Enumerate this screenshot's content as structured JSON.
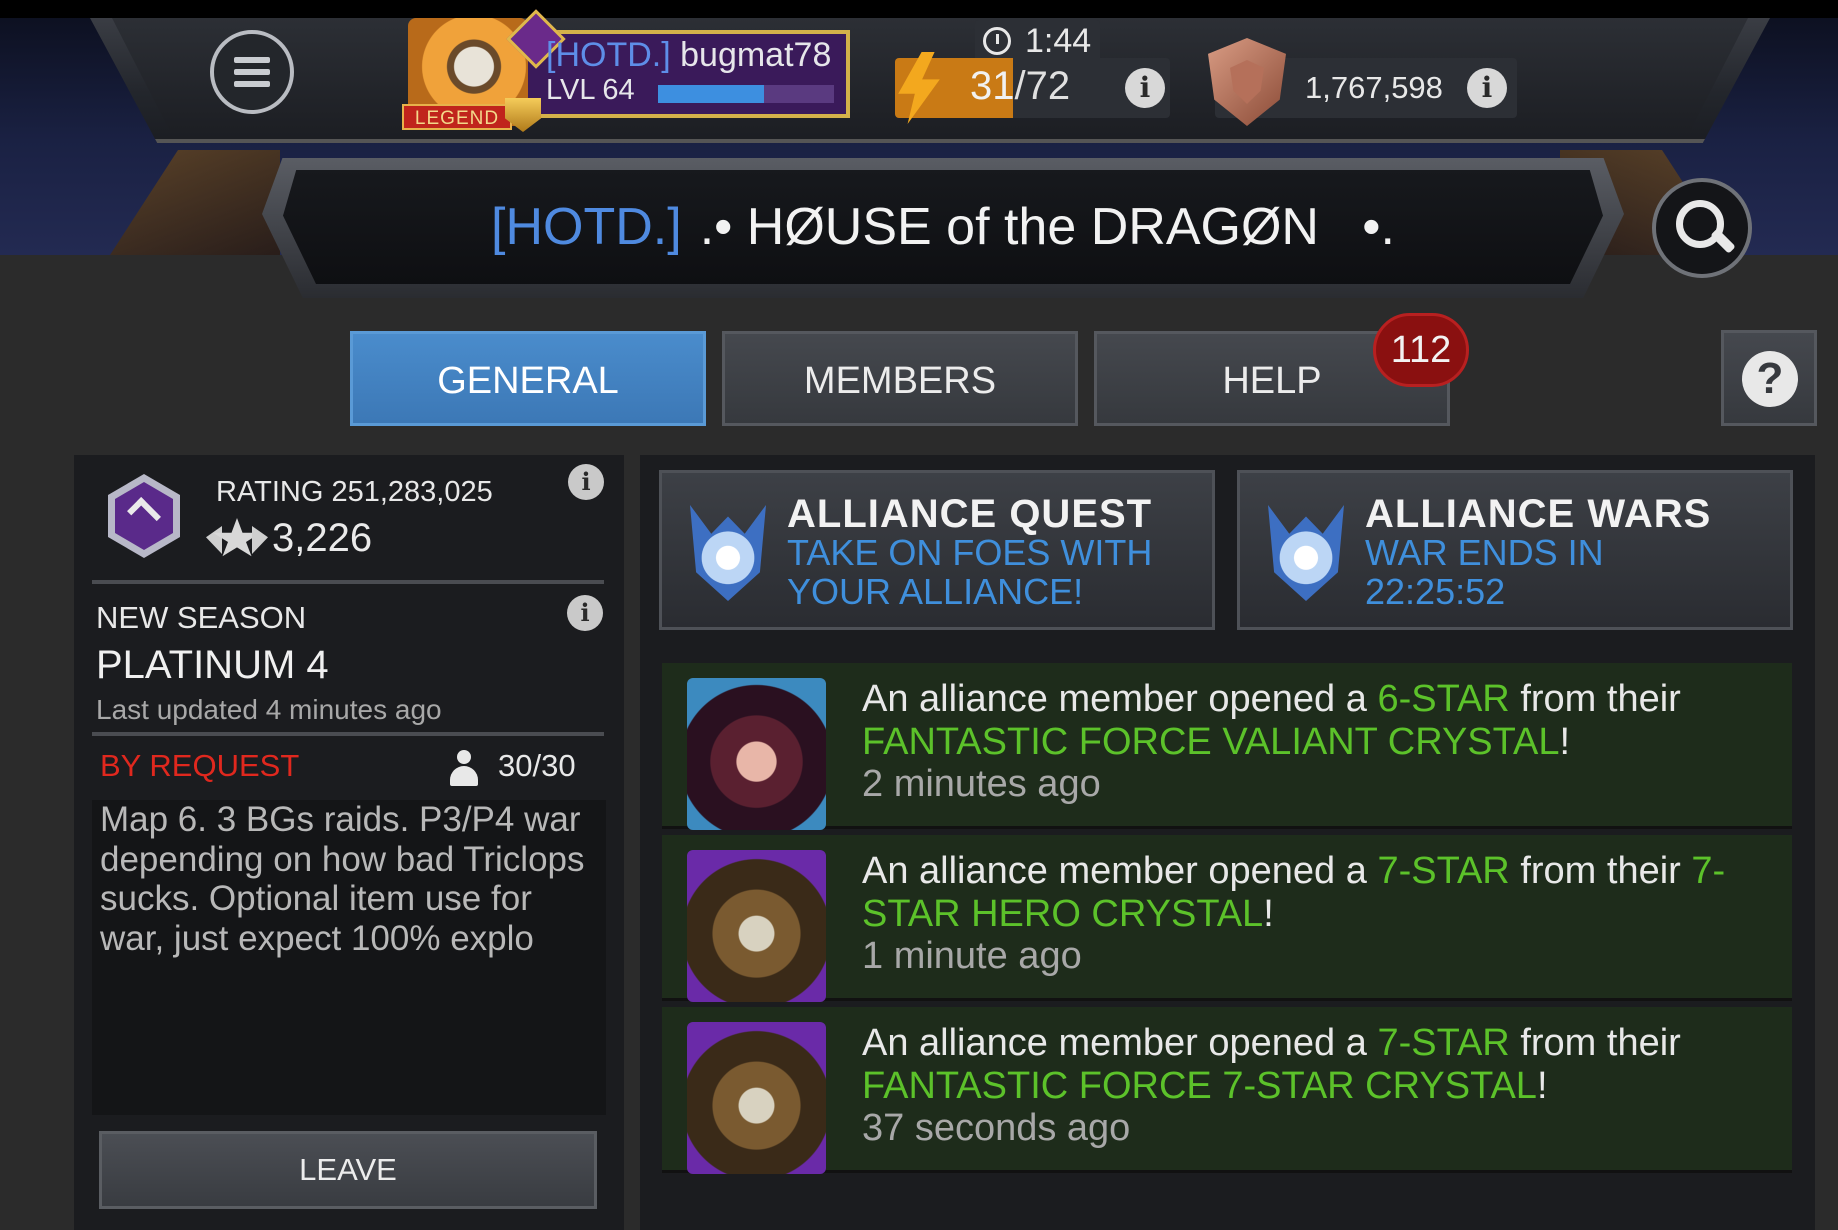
{
  "hud": {
    "player": {
      "tag": "[HOTD.]",
      "name": "bugmat78",
      "level": "LVL 64",
      "xp_fraction": 0.6,
      "rank_tag": "LEGEND"
    },
    "energy": {
      "timer": "1:44",
      "current": "31",
      "max": "/72",
      "fill_fraction": 0.43
    },
    "rating": "1,767,598"
  },
  "alliance": {
    "tag": "[HOTD.]",
    "name": ".• HØUSE of the DRAGØN   •."
  },
  "tabs": [
    {
      "label": "GENERAL",
      "active": true
    },
    {
      "label": "MEMBERS",
      "active": false
    },
    {
      "label": "HELP",
      "active": false
    }
  ],
  "help_badge": "112",
  "left": {
    "rating_label": "RATING 251,283,025",
    "trophies": "3,226",
    "season_label": "NEW SEASON",
    "season_value": "PLATINUM 4",
    "last_updated": "Last updated 4 minutes ago",
    "join_type": "BY REQUEST",
    "members": "30/30",
    "description": "Map 6. 3 BGs raids. P3/P4 war depending on how bad Triclops sucks. Optional item use for war, just expect 100% explo",
    "leave_label": "LEAVE"
  },
  "modes": [
    {
      "title": "ALLIANCE QUEST",
      "line1": "TAKE ON FOES WITH",
      "line2": "YOUR ALLIANCE!"
    },
    {
      "title": "ALLIANCE WARS",
      "line1": "WAR ENDS IN",
      "line2": "22:25:52"
    }
  ],
  "feed": [
    {
      "prefix": "An alliance member opened a ",
      "stars": "6-STAR",
      "middle": " from their ",
      "crystal": "FANTASTIC FORCE VALIANT CRYSTAL",
      "suffix": "!",
      "time": "2 minutes ago"
    },
    {
      "prefix": "An alliance member opened a ",
      "stars": "7-STAR",
      "middle": " from their ",
      "crystal": "7-STAR HERO CRYSTAL",
      "suffix": "!",
      "time": "1 minute ago"
    },
    {
      "prefix": "An alliance member opened a ",
      "stars": "7-STAR",
      "middle": " from their ",
      "crystal": "FANTASTIC FORCE 7-STAR CRYSTAL",
      "suffix": "!",
      "time": "37 seconds ago"
    }
  ],
  "colors": {
    "accent_blue": "#4a8ccc",
    "highlight_green": "#5cc22a",
    "alert_red": "#e0281e",
    "badge_red": "#8a1010"
  },
  "icons": [
    "menu-icon",
    "timer-icon",
    "energy-bolt-icon",
    "info-icon",
    "shield-icon",
    "search-icon",
    "help-icon",
    "alliance-hex-icon",
    "trophy-star-icon",
    "person-icon",
    "alliance-quest-icon",
    "alliance-wars-icon"
  ]
}
